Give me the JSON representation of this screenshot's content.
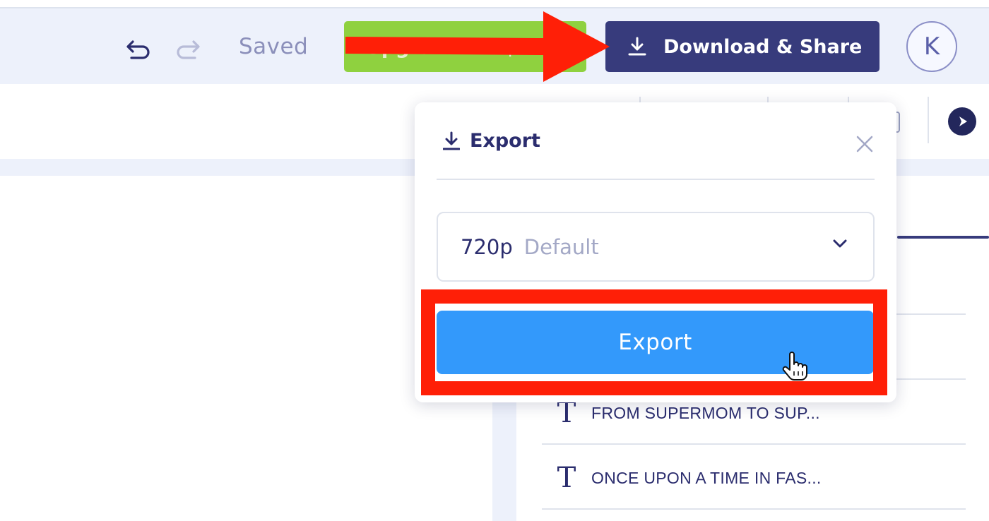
{
  "header": {
    "saved_label": "Saved",
    "upgrade_label": "Upgrade • ~$15/m",
    "download_label": "Download & Share",
    "avatar_initial": "K"
  },
  "export_popover": {
    "title": "Export",
    "quality_value": "720p",
    "quality_hint": "Default",
    "export_button_label": "Export"
  },
  "layers": [
    {
      "icon": "T",
      "label": "FROM SUPERMOM TO SUP..."
    },
    {
      "icon": "T",
      "label": "ONCE UPON A TIME IN FAS..."
    }
  ],
  "colors": {
    "accent_dark": "#373b7c",
    "export_blue": "#3399fb",
    "upgrade_green": "#8fd13f",
    "annotation_red": "#ff1f07"
  },
  "icons": [
    "undo-icon",
    "redo-icon",
    "download-icon",
    "close-icon",
    "chevron-down-icon",
    "play-icon",
    "text-layer-icon",
    "hand-cursor-icon"
  ]
}
